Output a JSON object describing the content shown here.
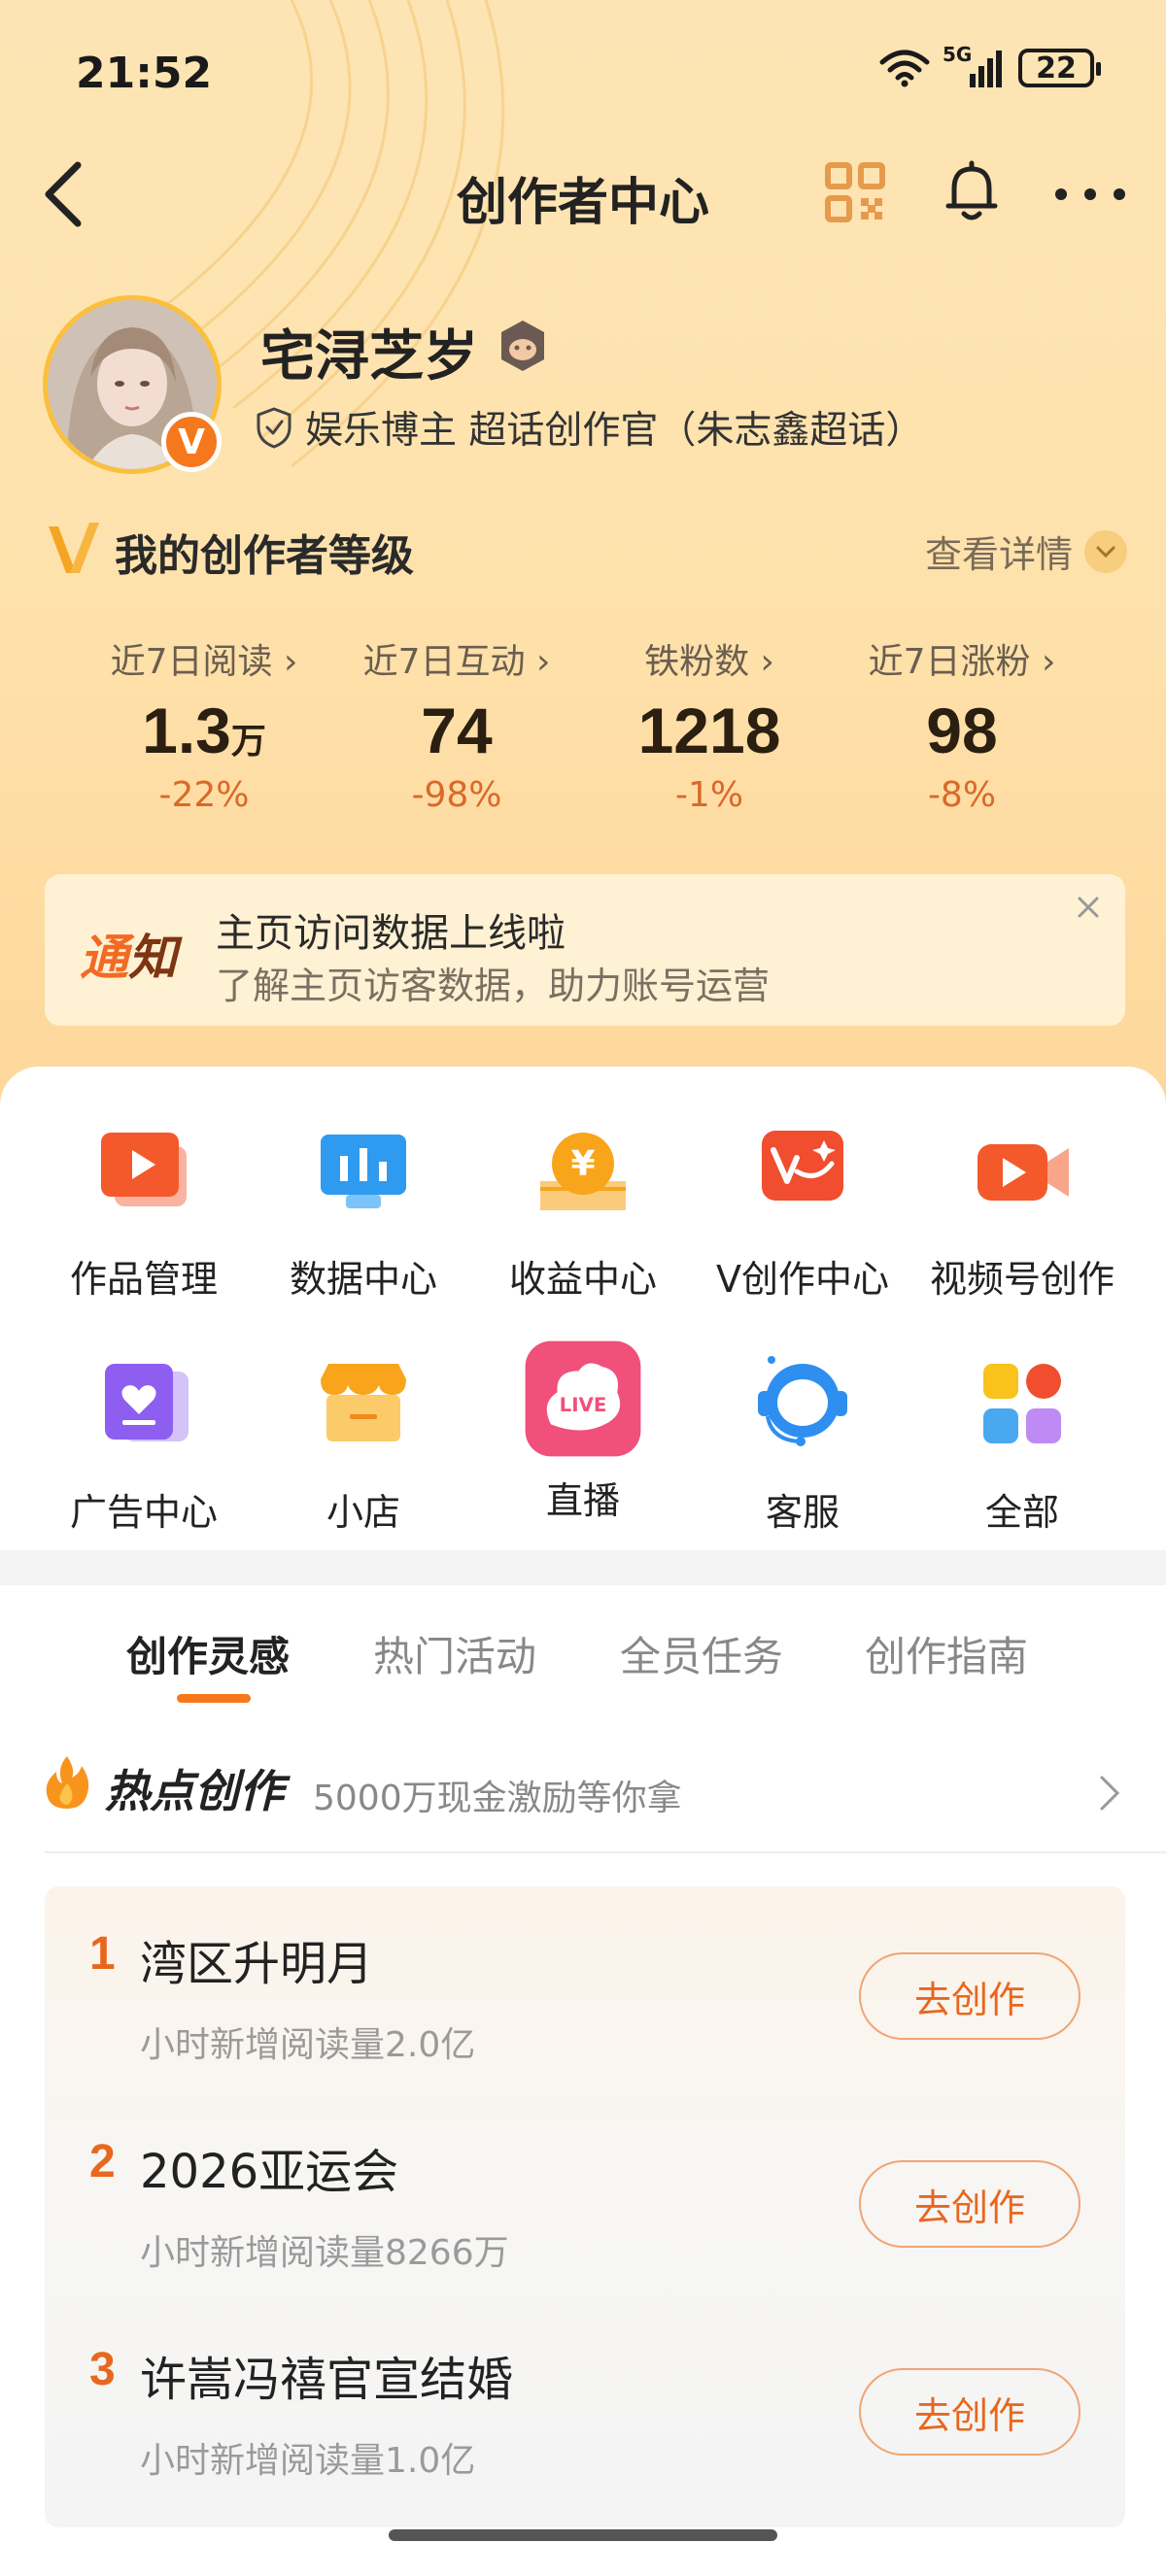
{
  "status_bar": {
    "time": "21:52",
    "network": "5G",
    "battery": "22"
  },
  "nav": {
    "title": "创作者中心"
  },
  "profile": {
    "username": "宅浔芝岁",
    "verified_mark": "V",
    "tag": "娱乐博主 超话创作官（朱志鑫超话）"
  },
  "level": {
    "title": "我的创作者等级",
    "detail_label": "查看详情"
  },
  "stats": [
    {
      "label": "近7日阅读",
      "value": "1.3",
      "unit": "万",
      "change": "-22%"
    },
    {
      "label": "近7日互动",
      "value": "74",
      "unit": "",
      "change": "-98%"
    },
    {
      "label": "铁粉数",
      "value": "1218",
      "unit": "",
      "change": "-1%"
    },
    {
      "label": "近7日涨粉",
      "value": "98",
      "unit": "",
      "change": "-8%"
    }
  ],
  "notice": {
    "tag_part1": "通",
    "tag_part2": "知",
    "title": "主页访问数据上线啦",
    "subtitle": "了解主页访客数据，助力账号运营"
  },
  "tools": [
    {
      "label": "作品管理",
      "icon": "works-management-icon",
      "color": "#f4592b"
    },
    {
      "label": "数据中心",
      "icon": "data-center-icon",
      "color": "#2f9bf0"
    },
    {
      "label": "收益中心",
      "icon": "revenue-center-icon",
      "color": "#f8a51c"
    },
    {
      "label": "V创作中心",
      "icon": "v-creation-icon",
      "color": "#f04e2e"
    },
    {
      "label": "视频号创作",
      "icon": "video-creation-icon",
      "color": "#f4592b"
    },
    {
      "label": "广告中心",
      "icon": "ad-center-icon",
      "color": "#8e5ef0"
    },
    {
      "label": "小店",
      "icon": "shop-icon",
      "color": "#f8b21c"
    },
    {
      "label": "直播",
      "icon": "live-icon",
      "color": "#f0507a"
    },
    {
      "label": "客服",
      "icon": "customer-service-icon",
      "color": "#2e8ff0"
    },
    {
      "label": "全部",
      "icon": "all-apps-icon",
      "color": "#f04e2e"
    }
  ],
  "tabs": [
    {
      "label": "创作灵感",
      "active": true
    },
    {
      "label": "热门活动",
      "active": false
    },
    {
      "label": "全员任务",
      "active": false
    },
    {
      "label": "创作指南",
      "active": false
    }
  ],
  "hot": {
    "title": "热点创作",
    "subtitle": "5000万现金激励等你拿",
    "items": [
      {
        "rank": "1",
        "name": "湾区升明月",
        "meta": "小时新增阅读量2.0亿",
        "button": "去创作"
      },
      {
        "rank": "2",
        "name": "2026亚运会",
        "meta": "小时新增阅读量8266万",
        "button": "去创作"
      },
      {
        "rank": "3",
        "name": "许嵩冯禧官宣结婚",
        "meta": "小时新增阅读量1.0亿",
        "button": "去创作"
      }
    ]
  },
  "colors": {
    "accent": "#f5781c",
    "header_bg": "#fee3ae",
    "stat_change": "#d9692a"
  }
}
